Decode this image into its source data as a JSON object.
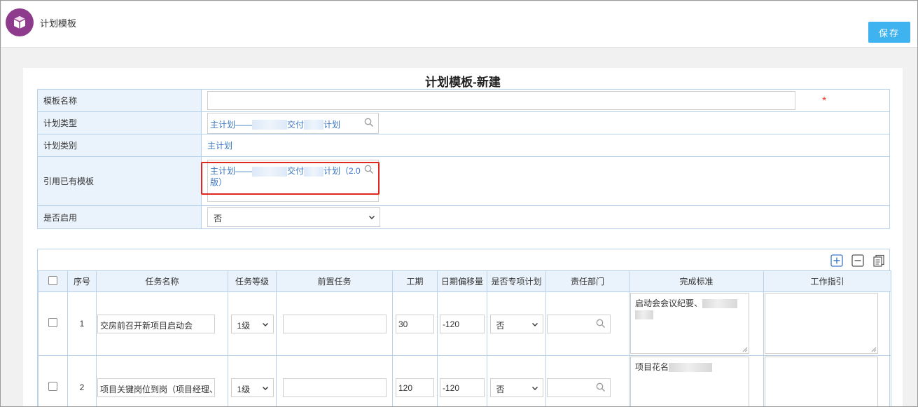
{
  "app": {
    "title": "计划模板"
  },
  "toolbar": {
    "save_label": "保存"
  },
  "form": {
    "title": "计划模板-新建",
    "fields": {
      "template_name": {
        "label": "模板名称",
        "value": "",
        "required_mark": "*"
      },
      "plan_type": {
        "label": "计划类型",
        "value_prefix": "主计划——",
        "value_mid": "交付",
        "value_suffix": "计划"
      },
      "plan_category": {
        "label": "计划类别",
        "value": "主计划"
      },
      "ref_template": {
        "label": "引用已有模板",
        "value_prefix": "主计划——",
        "value_mid": "交付",
        "value_suffix": "计划（2.0版）"
      },
      "enabled": {
        "label": "是否启用",
        "value": "否"
      }
    }
  },
  "grid": {
    "columns": [
      "序号",
      "任务名称",
      "任务等级",
      "前置任务",
      "工期",
      "日期偏移量",
      "是否专项计划",
      "责任部门",
      "完成标准",
      "工作指引"
    ],
    "rows": [
      {
        "seq": "1",
        "name": "交房前召开新项目启动会",
        "level": "1级",
        "pre": "",
        "duration": "30",
        "offset": "-120",
        "special": "否",
        "dept": "",
        "standard": "启动会会议纪要、",
        "guide": ""
      },
      {
        "seq": "2",
        "name": "项目关键岗位到岗（项目经理、",
        "level": "1级",
        "pre": "",
        "duration": "120",
        "offset": "-120",
        "special": "否",
        "dept": "",
        "standard": "项目花名",
        "guide": ""
      }
    ]
  },
  "colors": {
    "accent": "#3fb3ef",
    "logo": "#8e3b8d",
    "link": "#3d78c2",
    "border": "#b9d4ea",
    "label_bg": "#eaf3fc",
    "highlight": "#e0271f"
  },
  "icons": [
    "cube-icon",
    "search-icon",
    "chevron-down-icon",
    "add-row-icon",
    "remove-row-icon",
    "copy-row-icon"
  ]
}
